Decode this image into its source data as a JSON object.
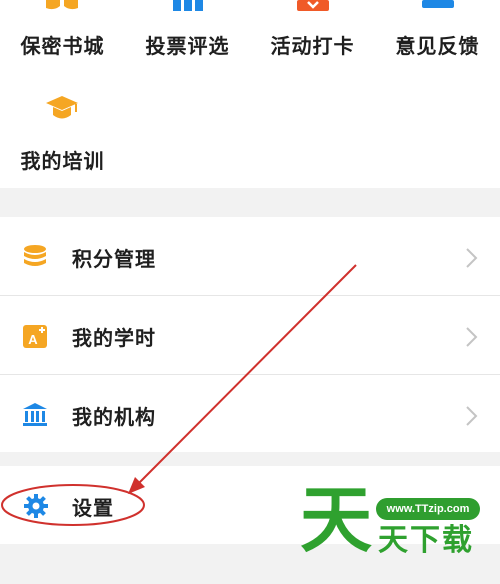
{
  "quick_grid": {
    "items": [
      {
        "label": "保密书城",
        "icon": "book-icon",
        "color": "#f5a623"
      },
      {
        "label": "投票评选",
        "icon": "bar-chart-icon",
        "color": "#1e88e5"
      },
      {
        "label": "活动打卡",
        "icon": "checkin-icon",
        "color": "#f05a28"
      },
      {
        "label": "意见反馈",
        "icon": "feedback-icon",
        "color": "#1e88e5"
      },
      {
        "label": "我的培训",
        "icon": "graduation-cap-icon",
        "color": "#f5a623"
      }
    ]
  },
  "menu": {
    "items": [
      {
        "label": "积分管理",
        "icon": "coins-icon",
        "color": "#f5a623"
      },
      {
        "label": "我的学时",
        "icon": "study-hours-icon",
        "color": "#f5a623"
      },
      {
        "label": "我的机构",
        "icon": "institution-icon",
        "color": "#1e88e5"
      }
    ]
  },
  "settings": {
    "label": "设置",
    "icon": "gear-icon",
    "color": "#1e88e5"
  },
  "annotation": {
    "color": "#d0312d"
  },
  "watermark": {
    "url": "www.TTzip.com",
    "big_char": "天",
    "text": "天下载",
    "color": "#2fa12f"
  }
}
